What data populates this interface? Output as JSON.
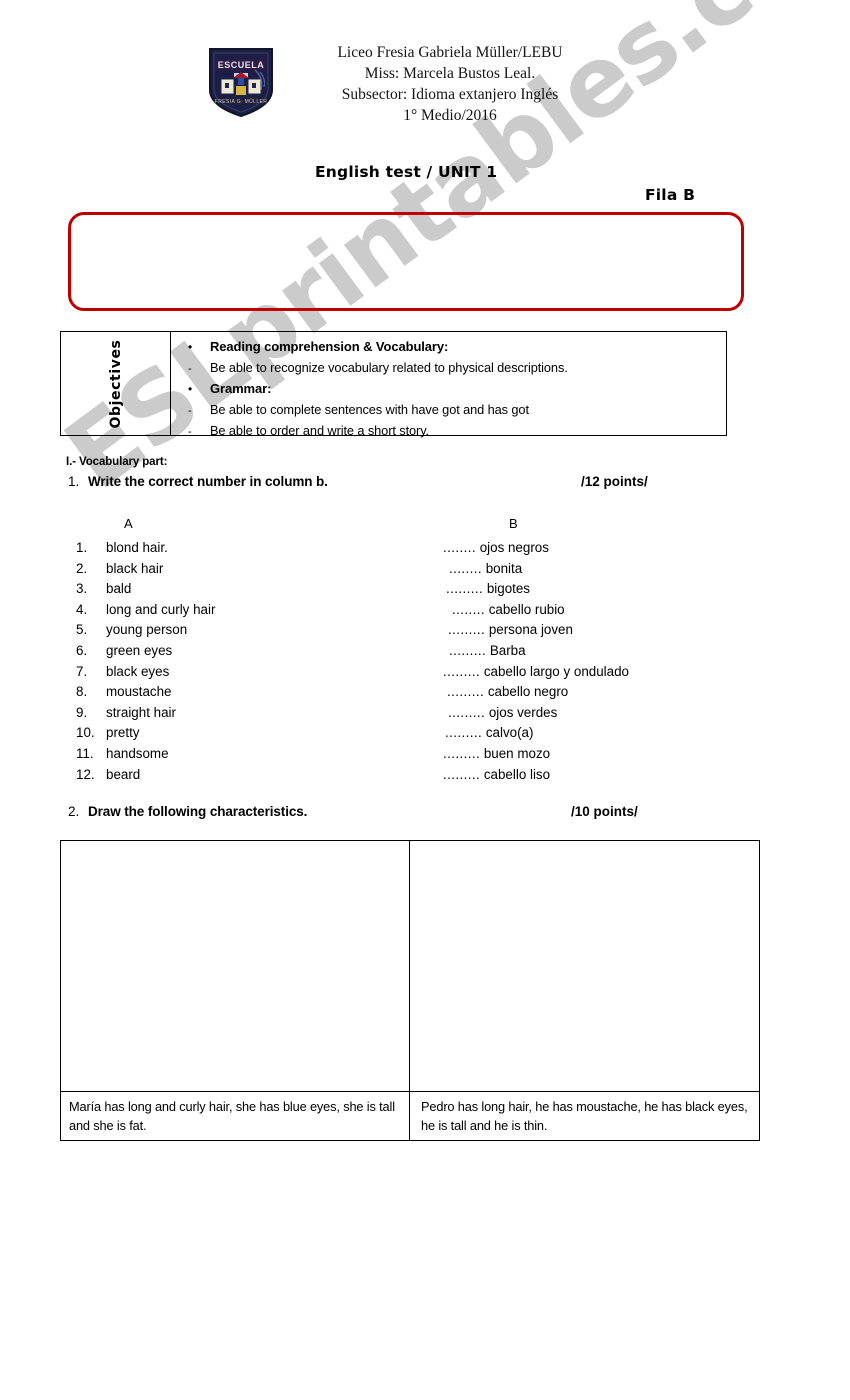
{
  "header": {
    "logo_alt": "school-crest",
    "crest_word": "ESCUELA",
    "lines": [
      "Liceo Fresia Gabriela Müller/LEBU",
      "Miss: Marcela Bustos Leal.",
      "Subsector: Idioma extanjero Inglés",
      "1° Medio/2016"
    ]
  },
  "title": "English test / UNIT 1",
  "row_label": "Fila B",
  "name_box": {
    "value": ""
  },
  "objectives": {
    "label": "Objectives",
    "items": [
      {
        "marker": "•",
        "text": "Reading comprehension & Vocabulary:",
        "bold": true
      },
      {
        "marker": "-",
        "text": "Be able to recognize vocabulary related to physical descriptions.",
        "bold": false
      },
      {
        "marker": "•",
        "text": "Grammar:",
        "bold": true
      },
      {
        "marker": "-",
        "text": "Be able to complete sentences with have got and has got",
        "bold": false
      },
      {
        "marker": "-",
        "text": "Be able to order and write a short story.",
        "bold": false
      }
    ]
  },
  "section_one": {
    "label": "I.- Vocabulary part:",
    "question1": {
      "number": "1.",
      "text": "Write the correct number in column b.",
      "points": "/12 points/"
    },
    "column_a_header": "A",
    "column_b_header": "B",
    "column_a": [
      {
        "index": "1.",
        "term": "blond hair."
      },
      {
        "index": "2.",
        "term": "black hair"
      },
      {
        "index": "3.",
        "term": "bald"
      },
      {
        "index": "4.",
        "term": "long and curly hair"
      },
      {
        "index": "5.",
        "term": "young person"
      },
      {
        "index": "6.",
        "term": "green eyes"
      },
      {
        "index": "7.",
        "term": "black eyes"
      },
      {
        "index": "8.",
        "term": "moustache"
      },
      {
        "index": "9.",
        "term": "straight hair"
      },
      {
        "index": "10.",
        "term": "pretty"
      },
      {
        "index": "11.",
        "term": "handsome"
      },
      {
        "index": "12.",
        "term": "beard"
      }
    ],
    "column_b": [
      {
        "blank": "........",
        "term": "ojos negros"
      },
      {
        "blank": "........",
        "term": "bonita"
      },
      {
        "blank": ".........",
        "term": "bigotes"
      },
      {
        "blank": "........",
        "term": "cabello rubio"
      },
      {
        "blank": ".........",
        "term": "persona joven"
      },
      {
        "blank": ".........",
        "term": "Barba"
      },
      {
        "blank": ".........",
        "term": "cabello largo y ondulado"
      },
      {
        "blank": ".........",
        "term": "cabello negro"
      },
      {
        "blank": ".........",
        "term": "ojos verdes"
      },
      {
        "blank": ".........",
        "term": "calvo(a)"
      },
      {
        "blank": ".........",
        "term": "buen mozo"
      },
      {
        "blank": ".........",
        "term": "cabello liso"
      }
    ],
    "question2": {
      "number": "2.",
      "text": "Draw the following characteristics.",
      "points": "/10 points/"
    },
    "drawing": {
      "left_caption": "María has long and curly hair, she has blue eyes, she is tall and she is fat.",
      "right_caption": "Pedro has long hair, he has moustache, he has black eyes, he is tall and he is thin.",
      "left_area_value": "",
      "right_area_value": ""
    }
  },
  "watermark": {
    "text": "ESLprintables.com",
    "color": "#cbcbcb"
  },
  "colors": {
    "name_box_border": "#c00000",
    "table_border": "#000000",
    "text": "#000000"
  }
}
